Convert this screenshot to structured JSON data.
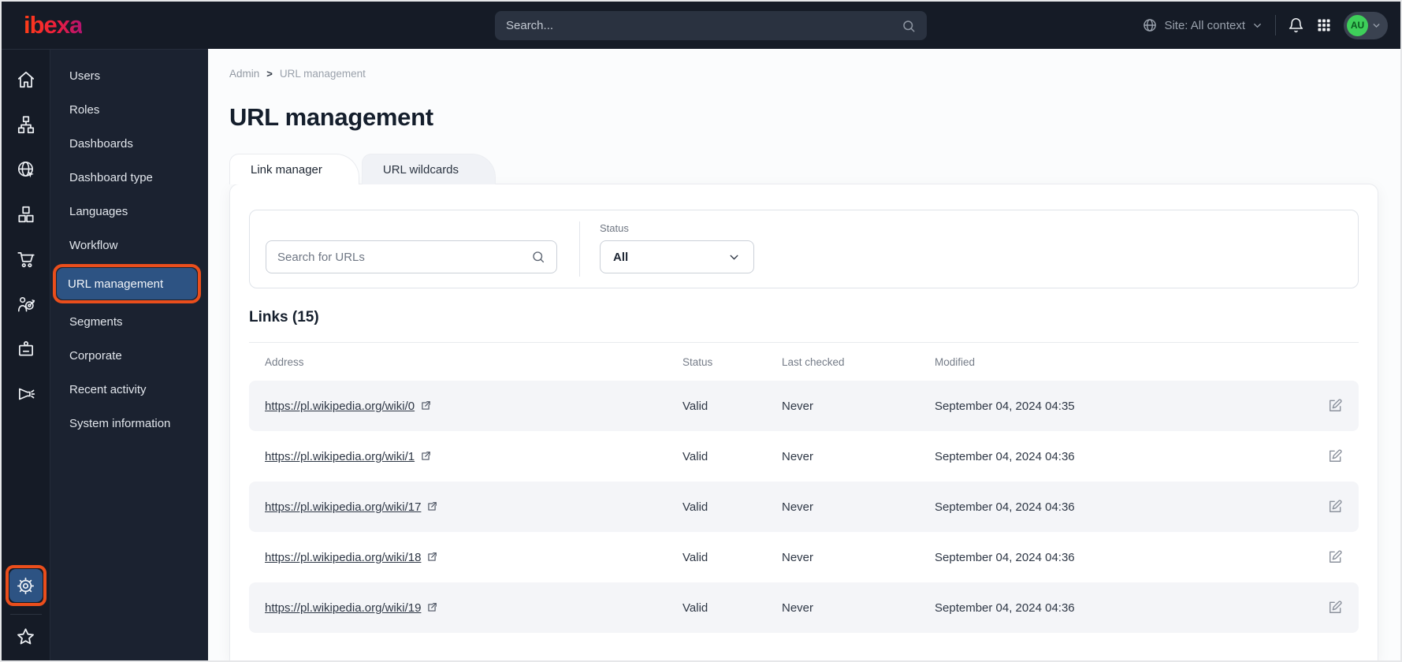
{
  "topbar": {
    "logo_text": "ibexa",
    "search_placeholder": "Search...",
    "site_label": "Site: All context",
    "avatar_initials": "AU"
  },
  "sidebar": {
    "menu_items": [
      {
        "label": "Users"
      },
      {
        "label": "Roles"
      },
      {
        "label": "Dashboards"
      },
      {
        "label": "Dashboard type"
      },
      {
        "label": "Languages"
      },
      {
        "label": "Workflow"
      },
      {
        "label": "URL management",
        "active": true
      },
      {
        "label": "Segments"
      },
      {
        "label": "Corporate"
      },
      {
        "label": "Recent activity"
      },
      {
        "label": "System information"
      }
    ],
    "rail_icons": [
      "home",
      "content-tree",
      "site",
      "product-catalog",
      "commerce",
      "customer-groups",
      "corporate",
      "marketing",
      "settings",
      "bookmarks"
    ]
  },
  "breadcrumb": {
    "items": [
      "Admin",
      "URL management"
    ],
    "separator": ">"
  },
  "page_title": "URL management",
  "tabs": [
    {
      "label": "Link manager",
      "active": true
    },
    {
      "label": "URL wildcards",
      "active": false
    }
  ],
  "filters": {
    "search_placeholder": "Search for URLs",
    "status_label": "Status",
    "status_value": "All"
  },
  "links_heading": "Links (15)",
  "table": {
    "headers": [
      "Address",
      "Status",
      "Last checked",
      "Modified"
    ],
    "rows": [
      {
        "address": "https://pl.wikipedia.org/wiki/0",
        "status": "Valid",
        "last_checked": "Never",
        "modified": "September 04, 2024 04:35"
      },
      {
        "address": "https://pl.wikipedia.org/wiki/1",
        "status": "Valid",
        "last_checked": "Never",
        "modified": "September 04, 2024 04:36"
      },
      {
        "address": "https://pl.wikipedia.org/wiki/17",
        "status": "Valid",
        "last_checked": "Never",
        "modified": "September 04, 2024 04:36"
      },
      {
        "address": "https://pl.wikipedia.org/wiki/18",
        "status": "Valid",
        "last_checked": "Never",
        "modified": "September 04, 2024 04:36"
      },
      {
        "address": "https://pl.wikipedia.org/wiki/19",
        "status": "Valid",
        "last_checked": "Never",
        "modified": "September 04, 2024 04:36"
      }
    ]
  },
  "colors": {
    "annotation_highlight": "#ea4e1c",
    "active_item_blue": "#2d5383",
    "topbar_bg": "#151b26",
    "avatar_green": "#3ecf5a"
  }
}
